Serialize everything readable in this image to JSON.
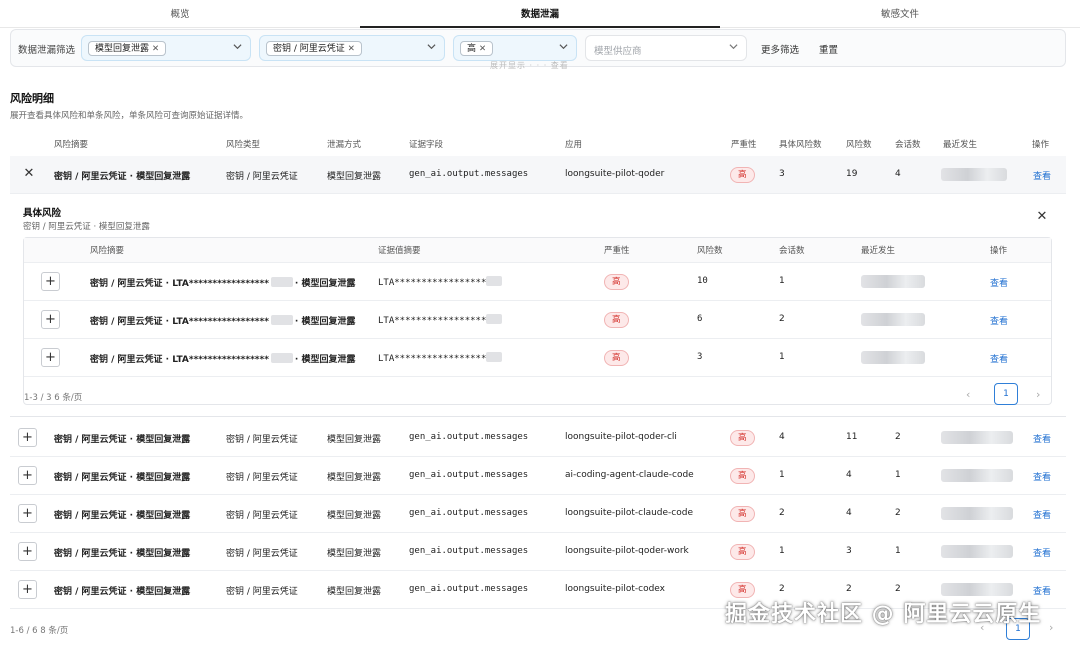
{
  "tabs": [
    {
      "label": "概览",
      "active": false
    },
    {
      "label": "数据泄漏",
      "active": true
    },
    {
      "label": "敏感文件",
      "active": false
    }
  ],
  "filters": {
    "label": "数据泄漏筛选",
    "type_chip": "模型回复泄露",
    "credential_chip": "密钥 / 阿里云凭证",
    "severity_chip": "高",
    "provider_placeholder": "模型供应商",
    "more_filters": "更多筛选",
    "reset": "重置",
    "clipped_text": "展开显示 · · · 查看"
  },
  "section": {
    "title": "风险明细",
    "subtitle": "展开查看具体风险和单条风险，单条风险可查询原始证据详情。"
  },
  "table": {
    "headers": {
      "summary": "风险摘要",
      "type": "风险类型",
      "method": "泄漏方式",
      "field": "证据字段",
      "app": "应用",
      "severity": "严重性",
      "specific_count": "具体风险数",
      "risk_count": "风险数",
      "session_count": "会话数",
      "last_seen": "最近发生",
      "action": "操作"
    },
    "rows": [
      {
        "summary": "密钥 / 阿里云凭证 · 模型回复泄露",
        "type": "密钥 / 阿里云凭证",
        "method": "模型回复泄露",
        "field": "gen_ai.output.messages",
        "app": "loongsuite-pilot-qoder",
        "severity": "高",
        "specific": "3",
        "risks": "19",
        "sessions": "4",
        "action": "查看"
      },
      {
        "summary": "密钥 / 阿里云凭证 · 模型回复泄露",
        "type": "密钥 / 阿里云凭证",
        "method": "模型回复泄露",
        "field": "gen_ai.output.messages",
        "app": "loongsuite-pilot-qoder-cli",
        "severity": "高",
        "specific": "4",
        "risks": "11",
        "sessions": "2",
        "action": "查看"
      },
      {
        "summary": "密钥 / 阿里云凭证 · 模型回复泄露",
        "type": "密钥 / 阿里云凭证",
        "method": "模型回复泄露",
        "field": "gen_ai.output.messages",
        "app": "ai-coding-agent-claude-code",
        "severity": "高",
        "specific": "1",
        "risks": "4",
        "sessions": "1",
        "action": "查看"
      },
      {
        "summary": "密钥 / 阿里云凭证 · 模型回复泄露",
        "type": "密钥 / 阿里云凭证",
        "method": "模型回复泄露",
        "field": "gen_ai.output.messages",
        "app": "loongsuite-pilot-claude-code",
        "severity": "高",
        "specific": "2",
        "risks": "4",
        "sessions": "2",
        "action": "查看"
      },
      {
        "summary": "密钥 / 阿里云凭证 · 模型回复泄露",
        "type": "密钥 / 阿里云凭证",
        "method": "模型回复泄露",
        "field": "gen_ai.output.messages",
        "app": "loongsuite-pilot-qoder-work",
        "severity": "高",
        "specific": "1",
        "risks": "3",
        "sessions": "1",
        "action": "查看"
      },
      {
        "summary": "密钥 / 阿里云凭证 · 模型回复泄露",
        "type": "密钥 / 阿里云凭证",
        "method": "模型回复泄露",
        "field": "gen_ai.output.messages",
        "app": "loongsuite-pilot-codex",
        "severity": "高",
        "specific": "2",
        "risks": "2",
        "sessions": "2",
        "action": "查看"
      }
    ],
    "pagination": "1-6 / 6  8 条/页",
    "page": "1"
  },
  "detail": {
    "title": "具体风险",
    "subtitle": "密钥 / 阿里云凭证 · 模型回复泄露",
    "headers": {
      "summary": "风险摘要",
      "value": "证据值摘要",
      "severity": "严重性",
      "risk_count": "风险数",
      "session_count": "会话数",
      "last_seen": "最近发生",
      "action": "操作"
    },
    "rows": [
      {
        "summary_prefix": "密钥 / 阿里云凭证 · LTA*****************",
        "summary_suffix": "· 模型回复泄露",
        "value": "LTA*****************",
        "severity": "高",
        "risks": "10",
        "sessions": "1",
        "action": "查看"
      },
      {
        "summary_prefix": "密钥 / 阿里云凭证 · LTA*****************",
        "summary_suffix": "· 模型回复泄露",
        "value": "LTA*****************",
        "severity": "高",
        "risks": "6",
        "sessions": "2",
        "action": "查看"
      },
      {
        "summary_prefix": "密钥 / 阿里云凭证 · LTA*****************",
        "summary_suffix": "· 模型回复泄露",
        "value": "LTA*****************",
        "severity": "高",
        "risks": "3",
        "sessions": "1",
        "action": "查看"
      }
    ],
    "pagination": "1-3 / 3  6 条/页",
    "page": "1"
  },
  "watermark": "掘金技术社区 @ 阿里云云原生",
  "colors": {
    "accent": "#1f6fd1",
    "danger": "#d4302a",
    "chip_bg": "#eef7fd"
  }
}
